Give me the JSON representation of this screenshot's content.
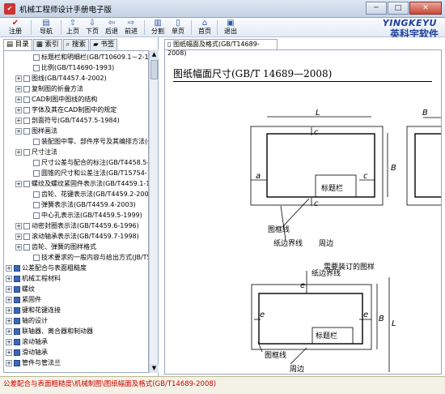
{
  "window": {
    "title": "机械工程师设计手册电子版",
    "btn_min": "─",
    "btn_max": "□",
    "btn_close": "✕"
  },
  "toolbar": {
    "buttons": [
      {
        "label": "注册",
        "icon": "✔"
      },
      {
        "label": "导航",
        "icon": "▤"
      },
      {
        "label": "上页",
        "icon": "⇧"
      },
      {
        "label": "下页",
        "icon": "⇩"
      },
      {
        "label": "后退",
        "icon": "⇦"
      },
      {
        "label": "前进",
        "icon": "⇨"
      },
      {
        "label": "分割",
        "icon": "▥"
      },
      {
        "label": "单页",
        "icon": "▯"
      },
      {
        "label": "首页",
        "icon": "⌂"
      },
      {
        "label": "退出",
        "icon": "▣"
      }
    ],
    "logo_en": "YINGKEYU",
    "logo_cn": "英科宇软件"
  },
  "left_tabs": [
    {
      "label": "目录"
    },
    {
      "label": "索引"
    },
    {
      "label": "搜索"
    },
    {
      "label": "书签"
    }
  ],
  "tree": [
    {
      "label": "标题栏和明细栏(GB/T10609.1－2-1989",
      "lvl": 3,
      "exp": "",
      "ico": "doc"
    },
    {
      "label": "比例(GB/T14690-1993)",
      "lvl": 3,
      "exp": "",
      "ico": "doc"
    },
    {
      "label": "图线(GB/T4457.4-2002)",
      "lvl": 2,
      "exp": "+",
      "ico": "doc"
    },
    {
      "label": "复制图的折叠方法",
      "lvl": 2,
      "exp": "+",
      "ico": "doc"
    },
    {
      "label": "CAD制图中图线的结构",
      "lvl": 2,
      "exp": "+",
      "ico": "doc"
    },
    {
      "label": "字体及其在CAD制图中的规定",
      "lvl": 2,
      "exp": "+",
      "ico": "doc"
    },
    {
      "label": "剖面符号(GB/T4457.5-1984)",
      "lvl": 2,
      "exp": "+",
      "ico": "doc"
    },
    {
      "label": "图样画法",
      "lvl": 2,
      "exp": "+",
      "ico": "doc"
    },
    {
      "label": "装配图中零、部件序号及其编排方法(GB",
      "lvl": 3,
      "exp": "",
      "ico": "doc"
    },
    {
      "label": "尺寸注法",
      "lvl": 2,
      "exp": "+",
      "ico": "doc"
    },
    {
      "label": "尺寸公差与配合的标注(GB/T4458.5-200",
      "lvl": 3,
      "exp": "",
      "ico": "doc"
    },
    {
      "label": "圆锥的尺寸和公差注法(GB/T15754-199",
      "lvl": 3,
      "exp": "",
      "ico": "doc"
    },
    {
      "label": "螺纹及螺纹紧固件表示法(GB/T4459.1-1",
      "lvl": 2,
      "exp": "+",
      "ico": "doc"
    },
    {
      "label": "齿轮、花键表示法(GB/T4459.2-2003,",
      "lvl": 3,
      "exp": "",
      "ico": "doc"
    },
    {
      "label": "弹簧表示法(GB/T4459.4-2003)",
      "lvl": 3,
      "exp": "",
      "ico": "doc"
    },
    {
      "label": "中心孔表示法(GB/T4459.5-1999)",
      "lvl": 3,
      "exp": "",
      "ico": "doc"
    },
    {
      "label": "动密封圈表示法(GB/T4459.6-1996)",
      "lvl": 2,
      "exp": "+",
      "ico": "doc"
    },
    {
      "label": "滚动轴承表示法(GB/T4459.7-1998)",
      "lvl": 2,
      "exp": "+",
      "ico": "doc"
    },
    {
      "label": "齿轮、弹簧的图样格式",
      "lvl": 2,
      "exp": "+",
      "ico": "doc"
    },
    {
      "label": "技术要求的一般内容与给出方式(JB/T50",
      "lvl": 3,
      "exp": "",
      "ico": "doc"
    },
    {
      "label": "公差配合与表面粗糙度",
      "lvl": 1,
      "exp": "+",
      "ico": "book"
    },
    {
      "label": "机械工程材料",
      "lvl": 1,
      "exp": "+",
      "ico": "book"
    },
    {
      "label": "螺纹",
      "lvl": 1,
      "exp": "+",
      "ico": "book"
    },
    {
      "label": "紧固件",
      "lvl": 1,
      "exp": "+",
      "ico": "book"
    },
    {
      "label": "键和花键连接",
      "lvl": 1,
      "exp": "+",
      "ico": "book"
    },
    {
      "label": "轴的设计",
      "lvl": 1,
      "exp": "+",
      "ico": "book"
    },
    {
      "label": "联轴器、离合器和制动器",
      "lvl": 1,
      "exp": "+",
      "ico": "book"
    },
    {
      "label": "滚动轴承",
      "lvl": 1,
      "exp": "+",
      "ico": "book"
    },
    {
      "label": "滑动轴承",
      "lvl": 1,
      "exp": "+",
      "ico": "book"
    },
    {
      "label": "管件与管法兰",
      "lvl": 1,
      "exp": "+",
      "ico": "book"
    }
  ],
  "doc": {
    "tab": "图纸幅面及格式(GB/T14689-2008)",
    "title": "图纸幅面尺寸(GB/T 14689—2008)",
    "fig1": {
      "L": "L",
      "B": "B",
      "a": "a",
      "c": "c",
      "border_label": "图框线",
      "edge_label": "纸边界线",
      "edge_label2": "周边",
      "titleblock": "标题栏",
      "caption": "需要装订的图样"
    },
    "fig2": {
      "edge_label": "纸边界线",
      "e": "e",
      "titleblock": "标题栏",
      "border_label": "图框线",
      "periphery": "周边",
      "B": "B",
      "L": "L"
    }
  },
  "status": {
    "path": "公差配合与表面粗糙度\\机械制图\\图纸幅面及格式(GB/T14689-2008)"
  }
}
